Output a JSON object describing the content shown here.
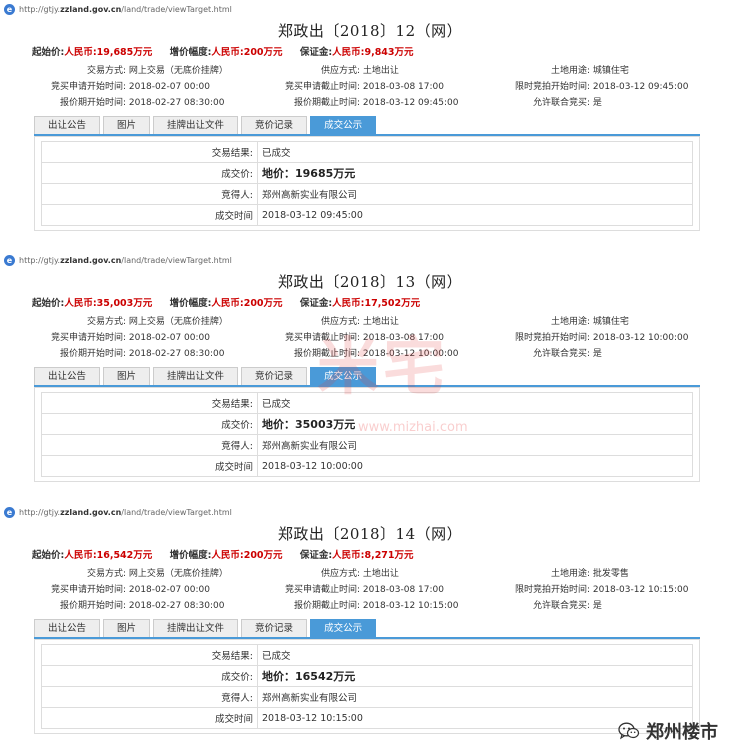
{
  "url": "http://gtjy.zzland.gov.cn/land/trade/viewTarget.html",
  "url_prefix": "http://gtjy.",
  "url_domain": "zzland.gov.cn",
  "url_path": "/land/trade/viewTarget.html",
  "labels": {
    "start_price": "起始价:",
    "increment": "增价幅度:",
    "deposit": "保证金:",
    "trade_mode": "交易方式:",
    "supply_mode": "供应方式:",
    "land_use": "土地用途:",
    "apply_start": "竞买申请开始时间:",
    "apply_end": "竞买申请截止时间:",
    "auction_start": "限时竞拍开始时间:",
    "quote_start": "报价期开始时间:",
    "quote_end": "报价期截止时间:",
    "joint_bid": "允许联合竞买:",
    "result": "交易结果:",
    "deal_price": "成交价:",
    "winner": "竞得人:",
    "deal_time": "成交时间"
  },
  "tabs": [
    "出让公告",
    "图片",
    "挂牌出让文件",
    "竞价记录",
    "成交公示"
  ],
  "watermark": {
    "logo": "米宅",
    "url": "www.mizhai.com"
  },
  "brand": {
    "name": "郑州楼市",
    "icon": "wechat-icon"
  },
  "panels": [
    {
      "title": "郑政出〔2018〕12（网）",
      "start_price": "人民币:19,685万元",
      "increment": "人民币:200万元",
      "deposit": "人民币:9,843万元",
      "trade_mode": "网上交易（无底价挂牌）",
      "supply_mode": "土地出让",
      "land_use": "城镇住宅",
      "apply_start": "2018-02-07 00:00",
      "apply_end": "2018-03-08 17:00",
      "auction_start": "2018-03-12 09:45:00",
      "quote_start": "2018-02-27 08:30:00",
      "quote_end": "2018-03-12 09:45:00",
      "joint_bid": "是",
      "result": "已成交",
      "deal_price": "地价：19685万元",
      "winner": "郑州高新实业有限公司",
      "deal_time": "2018-03-12 09:45:00"
    },
    {
      "title": "郑政出〔2018〕13（网）",
      "start_price": "人民币:35,003万元",
      "increment": "人民币:200万元",
      "deposit": "人民币:17,502万元",
      "trade_mode": "网上交易（无底价挂牌）",
      "supply_mode": "土地出让",
      "land_use": "城镇住宅",
      "apply_start": "2018-02-07 00:00",
      "apply_end": "2018-03-08 17:00",
      "auction_start": "2018-03-12 10:00:00",
      "quote_start": "2018-02-27 08:30:00",
      "quote_end": "2018-03-12 10:00:00",
      "joint_bid": "是",
      "result": "已成交",
      "deal_price": "地价：35003万元",
      "winner": "郑州高新实业有限公司",
      "deal_time": "2018-03-12 10:00:00"
    },
    {
      "title": "郑政出〔2018〕14（网）",
      "start_price": "人民币:16,542万元",
      "increment": "人民币:200万元",
      "deposit": "人民币:8,271万元",
      "trade_mode": "网上交易（无底价挂牌）",
      "supply_mode": "土地出让",
      "land_use": "批发零售",
      "apply_start": "2018-02-07 00:00",
      "apply_end": "2018-03-08 17:00",
      "auction_start": "2018-03-12 10:15:00",
      "quote_start": "2018-02-27 08:30:00",
      "quote_end": "2018-03-12 10:15:00",
      "joint_bid": "是",
      "result": "已成交",
      "deal_price": "地价：16542万元",
      "winner": "郑州高新实业有限公司",
      "deal_time": "2018-03-12 10:15:00"
    }
  ]
}
